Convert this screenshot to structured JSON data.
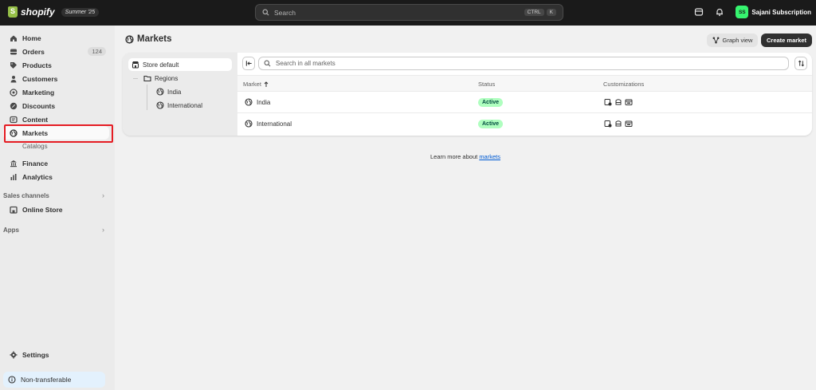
{
  "topbar": {
    "brand": "shopify",
    "edition": "Summer '25",
    "search_placeholder": "Search",
    "shortcut_keys": [
      "CTRL",
      "K"
    ],
    "user_initials": "SS",
    "user_name": "Sajani Subscription",
    "avatar_color": "#36f46f"
  },
  "sidebar": {
    "items": [
      {
        "label": "Home",
        "icon": "home-icon"
      },
      {
        "label": "Orders",
        "icon": "orders-icon",
        "count": "124"
      },
      {
        "label": "Products",
        "icon": "tag-icon"
      },
      {
        "label": "Customers",
        "icon": "person-icon"
      },
      {
        "label": "Marketing",
        "icon": "target-icon"
      },
      {
        "label": "Discounts",
        "icon": "discount-icon"
      },
      {
        "label": "Content",
        "icon": "content-icon"
      },
      {
        "label": "Markets",
        "icon": "globe-icon"
      },
      {
        "label": "Finance",
        "icon": "bank-icon"
      },
      {
        "label": "Analytics",
        "icon": "bar-chart-icon"
      }
    ],
    "sub_catalogs": "Catalogs",
    "sales_channels_label": "Sales channels",
    "online_store": "Online Store",
    "apps_label": "Apps",
    "settings": "Settings",
    "banner": "Non-transferable"
  },
  "page": {
    "title": "Markets",
    "graph_view": "Graph view",
    "create_market": "Create market"
  },
  "tree": {
    "store_default": "Store default",
    "regions": "Regions",
    "india": "India",
    "international": "International"
  },
  "table": {
    "search_placeholder": "Search in all markets",
    "headers": {
      "market": "Market",
      "status": "Status",
      "customizations": "Customizations"
    },
    "rows": [
      {
        "market": "India",
        "status": "Active"
      },
      {
        "market": "International",
        "status": "Active"
      }
    ]
  },
  "footer": {
    "learn_prefix": "Learn more about",
    "learn_link": "markets"
  },
  "colors": {
    "active_badge_bg": "#affebf",
    "highlight_border": "#e51c23",
    "link": "#005bd3"
  }
}
